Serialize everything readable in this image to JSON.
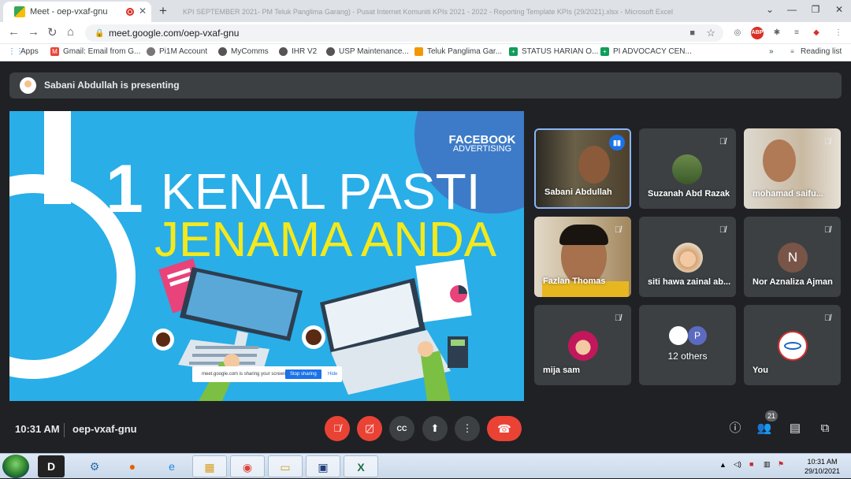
{
  "browser": {
    "active_tab_title": "Meet - oep-vxaf-gnu",
    "background_tab_title": "KPI SEPTEMBER 2021- PM Teluk Panglima Garang) - Pusat Internet Komuniti KPIs 2021 - 2022 - Reporting Template KPIs (29/2021).xlsx - Microsoft Excel",
    "url": "meet.google.com/oep-vxaf-gnu",
    "bookmarks": [
      "Apps",
      "Gmail: Email from G...",
      "Pi1M Account",
      "MyComms",
      "IHR V2",
      "USP Maintenance...",
      "Teluk Panglima Gar...",
      "STATUS HARIAN O...",
      "PI ADVOCACY CEN..."
    ],
    "reading_list": "Reading list",
    "abp_label": "ABP"
  },
  "meet": {
    "presenting_banner": "Sabani Abdullah is presenting",
    "slide": {
      "brand_line1": "FACEBOOK",
      "brand_line2": "ADVERTISING",
      "number": "1",
      "title_line1": "KENAL PASTI",
      "title_line2": "JENAMA ANDA",
      "share_bar_text": "meet.google.com is sharing your screen.",
      "stop_sharing": "Stop sharing",
      "hide": "Hide"
    },
    "participants": [
      {
        "name": "Sabani Abdullah",
        "speaking": true
      },
      {
        "name": "Suzanah Abd Razak",
        "muted": true
      },
      {
        "name": "mohamad saifu...",
        "muted": true
      },
      {
        "name": "Fazlan Thomas",
        "muted": true
      },
      {
        "name": "siti hawa zainal ab...",
        "muted": true
      },
      {
        "name": "Nor Aznaliza Ajman",
        "muted": true,
        "initial": "N"
      },
      {
        "name": "mija sam",
        "muted": true
      },
      {
        "name": "12 others",
        "initial": "P"
      },
      {
        "name": "You",
        "muted": true
      }
    ],
    "time": "10:31 AM",
    "meeting_code": "oep-vxaf-gnu",
    "participant_count": "21"
  },
  "taskbar": {
    "time": "10:31 AM",
    "date": "29/10/2021"
  },
  "colors": {
    "slide_bg": "#29aee8",
    "title_white": "#ffffff",
    "title_yellow": "#f5e91b",
    "leave_red": "#ea4335"
  }
}
